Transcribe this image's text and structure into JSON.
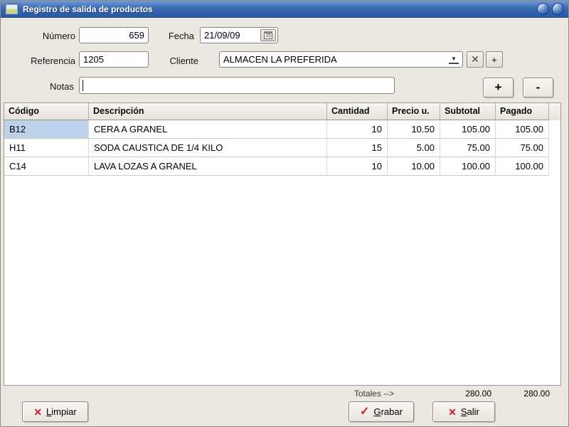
{
  "window": {
    "title": "Registro de salida de productos"
  },
  "form": {
    "numero": {
      "label": "Número",
      "value": "659"
    },
    "fecha": {
      "label": "Fecha",
      "value": "21/09/09",
      "calendar_glyph": "15"
    },
    "referencia": {
      "label": "Referencia",
      "value": "1205"
    },
    "cliente": {
      "label": "Cliente",
      "value": "ALMACEN LA PREFERIDA"
    },
    "notas": {
      "label": "Notas",
      "value": ""
    }
  },
  "icons": {
    "dropdown_arrow": "▼",
    "clear_client": "✕",
    "add_client": "+",
    "add_row": "+",
    "remove_row": "-",
    "red_x": "✕",
    "red_check": "✓"
  },
  "table": {
    "headers": [
      "Código",
      "Descripción",
      "Cantidad",
      "Precio u.",
      "Subtotal",
      "Pagado"
    ],
    "rows": [
      {
        "codigo": "B12",
        "descripcion": "CERA A GRANEL",
        "cantidad": "10",
        "precio": "10.50",
        "subtotal": "105.00",
        "pagado": "105.00"
      },
      {
        "codigo": "H11",
        "descripcion": "SODA CAUSTICA DE 1/4 KILO",
        "cantidad": "15",
        "precio": "5.00",
        "subtotal": "75.00",
        "pagado": "75.00"
      },
      {
        "codigo": "C14",
        "descripcion": "LAVA LOZAS A GRANEL",
        "cantidad": "10",
        "precio": "10.00",
        "subtotal": "100.00",
        "pagado": "100.00"
      }
    ]
  },
  "totals": {
    "label": "Totales -->",
    "subtotal": "280.00",
    "pagado": "280.00"
  },
  "actions": {
    "limpiar": {
      "mnemonic": "L",
      "rest": "impiar"
    },
    "grabar": {
      "mnemonic": "G",
      "rest": "rabar"
    },
    "salir": {
      "mnemonic": "S",
      "rest": "alir"
    }
  },
  "colors": {
    "titlebar_blue": "#3a6cb4",
    "selection_blue": "#bdd1eb",
    "action_red": "#cf1d1d",
    "window_bg": "#ebe8e2"
  }
}
